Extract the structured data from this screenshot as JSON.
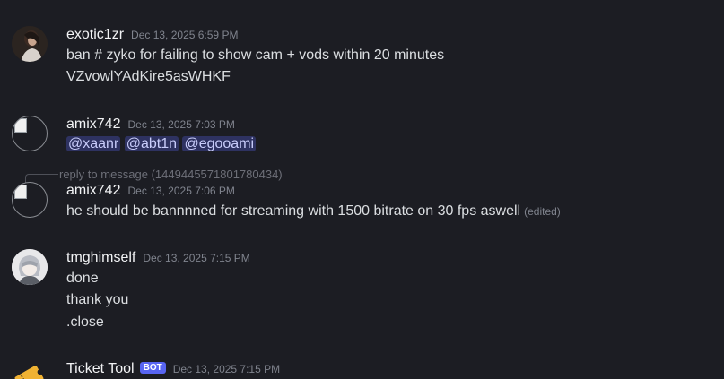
{
  "messages": [
    {
      "username": "exotic1zr",
      "timestamp": "Dec 13, 2025 6:59 PM",
      "lines": [
        "ban # zyko for failing to show  cam + vods within 20 minutes",
        "VZvowlYAdKire5asWHKF"
      ]
    },
    {
      "username": "amix742",
      "timestamp": "Dec 13, 2025 7:03 PM",
      "mentions": [
        "@xaanr",
        "@abt1n",
        "@egooami"
      ]
    },
    {
      "reply_text": "reply to message (1449445571801780434)",
      "username": "amix742",
      "timestamp": "Dec 13, 2025 7:06 PM",
      "text": "he should be bannnned for streaming with 1500 bitrate on 30 fps aswell",
      "edited": "(edited)"
    },
    {
      "username": "tmghimself",
      "timestamp": "Dec 13, 2025 7:15 PM",
      "lines": [
        "done",
        "thank you",
        ".close"
      ]
    },
    {
      "username": "Ticket Tool",
      "badge": "BOT",
      "timestamp": "Dec 13, 2025 7:15 PM"
    }
  ],
  "colors": {
    "background": "#1c1d23",
    "username": "#f2f3f5",
    "text": "#dbdee1",
    "timestamp": "#80848e",
    "mention_bg": "#5865f24d",
    "bot_badge": "#5865f2",
    "ticket_icon": "#f0b232"
  }
}
